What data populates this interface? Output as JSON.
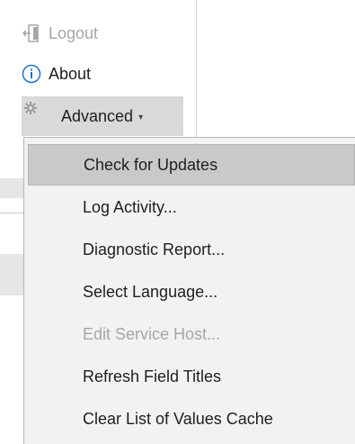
{
  "ribbon": {
    "logout": {
      "label": "Logout",
      "icon": "logout-icon"
    },
    "about": {
      "label": "About",
      "icon": "info-icon"
    },
    "advanced": {
      "label": "Advanced",
      "icon": "gear-icon",
      "caret": "▾"
    }
  },
  "advanced_menu": {
    "items": [
      {
        "label": "Check for Updates",
        "selected": true,
        "disabled": false
      },
      {
        "label": "Log Activity...",
        "selected": false,
        "disabled": false
      },
      {
        "label": "Diagnostic Report...",
        "selected": false,
        "disabled": false
      },
      {
        "label": "Select Language...",
        "selected": false,
        "disabled": false
      },
      {
        "label": "Edit Service Host...",
        "selected": false,
        "disabled": true
      },
      {
        "label": "Refresh Field Titles",
        "selected": false,
        "disabled": false
      },
      {
        "label": "Clear List of Values Cache",
        "selected": false,
        "disabled": false
      }
    ]
  },
  "colors": {
    "disabled_text": "#a6a6a6",
    "highlight": "#c9c9c9",
    "info_blue": "#1e6fd0"
  }
}
